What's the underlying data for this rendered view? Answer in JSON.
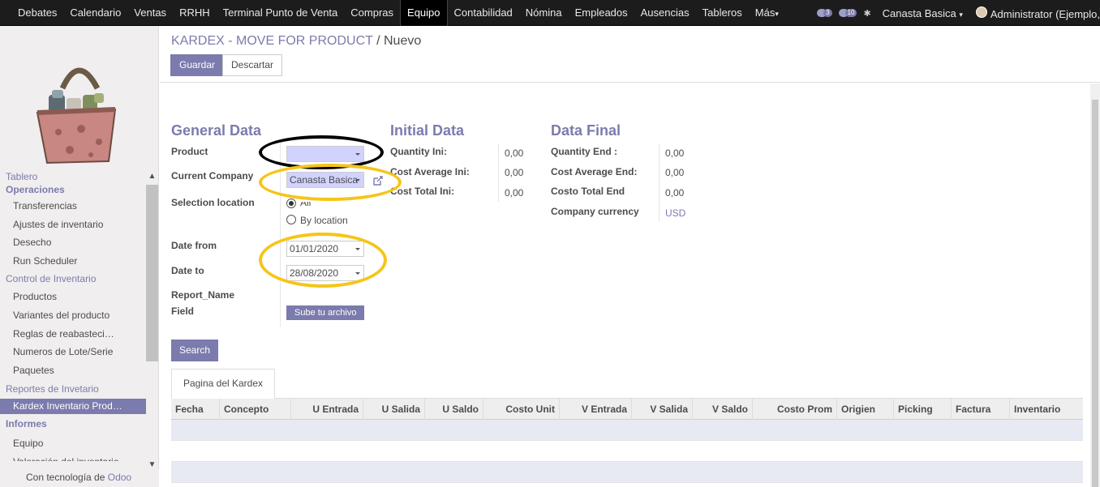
{
  "topbar": {
    "menu": [
      "Debates",
      "Calendario",
      "Ventas",
      "RRHH",
      "Terminal Punto de Venta",
      "Compras",
      "Equipo",
      "Contabilidad",
      "Nómina",
      "Empleados",
      "Ausencias",
      "Tableros",
      "Más"
    ],
    "active": "Equipo",
    "more_caret": "▾",
    "msg_badge": "3",
    "chat_badge": "10",
    "company": "Canasta Basica",
    "user": "Administrator (Ejemplo,"
  },
  "sidebar": {
    "sections": [
      {
        "title": "Tablero",
        "items": []
      },
      {
        "title": "Operaciones",
        "items": [
          "Transferencias",
          "Ajustes de inventario",
          "Desecho",
          "Run Scheduler"
        ]
      },
      {
        "title": "Control de Inventario",
        "items": [
          "Productos",
          "Variantes del producto",
          "Reglas de reabasteci…",
          "Numeros de Lote/Serie",
          "Paquetes"
        ]
      },
      {
        "title": "Reportes de Invetario",
        "items": [
          "Kardex Inventario Prod…"
        ]
      },
      {
        "title": "Informes",
        "items": [
          "Equipo",
          "Valoración del inventario"
        ]
      }
    ],
    "powered_prefix": "Con tecnología de ",
    "powered_brand": "Odoo"
  },
  "breadcrumb": {
    "parent": "KARDEX - MOVE FOR PRODUCT",
    "sep": "/",
    "current": "Nuevo"
  },
  "buttons": {
    "save": "Guardar",
    "discard": "Descartar",
    "search": "Search",
    "upload": "Sube tu archivo"
  },
  "general": {
    "title": "General Data",
    "product_label": "Product",
    "product_value": "",
    "company_label": "Current Company",
    "company_value": "Canasta Basica",
    "location_label": "Selection location",
    "radio_all": "All",
    "radio_by_location": "By location",
    "date_from_label": "Date from",
    "date_from": "01/01/2020",
    "date_to_label": "Date to",
    "date_to": "28/08/2020",
    "report_label_1": "Report_Name",
    "report_label_2": "Field"
  },
  "initial": {
    "title": "Initial Data",
    "qty_label": "Quantity Ini:",
    "qty": "0,00",
    "cost_avg_label": "Cost Average Ini:",
    "cost_avg": "0,00",
    "cost_total_label": "Cost Total Ini:",
    "cost_total": "0,00"
  },
  "final": {
    "title": "Data Final",
    "qty_label": "Quantity End :",
    "qty": "0,00",
    "cost_avg_label": "Cost Average End:",
    "cost_avg": "0,00",
    "cost_total_label": "Costo Total End",
    "cost_total": "0,00",
    "currency_label": "Company currency",
    "currency": "USD"
  },
  "tab": "Pagina del Kardex",
  "table": {
    "columns": [
      "Fecha",
      "Concepto",
      "U Entrada",
      "U Salida",
      "U Saldo",
      "Costo Unit",
      "V Entrada",
      "V Salida",
      "V Saldo",
      "Costo Prom",
      "Origien",
      "Picking",
      "Factura",
      "Inventario"
    ]
  },
  "colors": {
    "accent": "#7c7bad",
    "topbar": "#1c1c1c",
    "ring_black": "#000000",
    "ring_yellow": "#f5c518"
  }
}
